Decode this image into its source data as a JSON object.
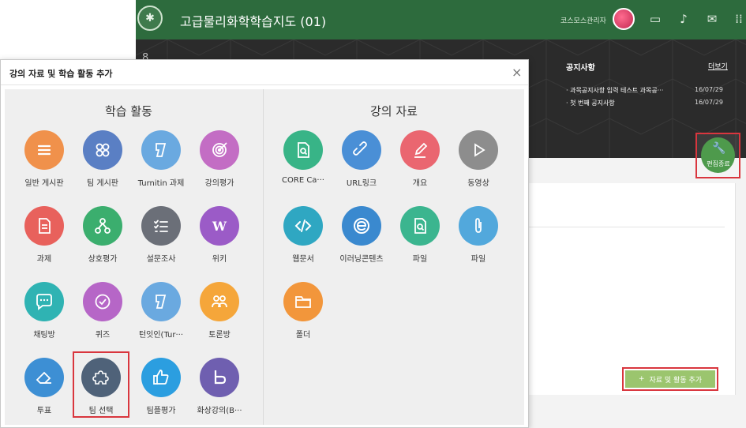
{
  "bg": {
    "course_title": "고급물리화학학습지도 (01)",
    "user_name": "코스모스관리자",
    "notice_title": "공지사항",
    "notice_more": "더보기",
    "notices": [
      {
        "text": "· 과목공지사항 입력 테스트 과목공···",
        "date": "16/07/29"
      },
      {
        "text": "· 첫 번째 공지사항",
        "date": "16/07/29"
      }
    ],
    "edit_done_label": "편집종료",
    "add_button_label": "자료 및 활동 추가",
    "add_button_icon": "+"
  },
  "modal": {
    "title": "강의 자료 및 학습 활동 추가",
    "close": "×",
    "activities_title": "학습 활동",
    "resources_title": "강의 자료",
    "activities": [
      {
        "label": "일반 게시판",
        "icon": "list-icon",
        "color": "#f0914b"
      },
      {
        "label": "팀 게시판",
        "icon": "grid-circles-icon",
        "color": "#5a7fc4"
      },
      {
        "label": "Turnitin 과제",
        "icon": "turnitin-icon",
        "color": "#6aa9e0"
      },
      {
        "label": "강의평가",
        "icon": "target-icon",
        "color": "#c36dc4"
      },
      {
        "label": "과제",
        "icon": "document-icon",
        "color": "#e8615c"
      },
      {
        "label": "상호평가",
        "icon": "network-icon",
        "color": "#3bae6e"
      },
      {
        "label": "설문조사",
        "icon": "checklist-icon",
        "color": "#6b6f78"
      },
      {
        "label": "위키",
        "icon": "wiki-icon",
        "color": "#9b5bc7"
      },
      {
        "label": "채팅방",
        "icon": "chat-icon",
        "color": "#2fb3b3"
      },
      {
        "label": "퀴즈",
        "icon": "check-circle-icon",
        "color": "#b666c7"
      },
      {
        "label": "턴잇인(Tur···",
        "icon": "turnitin-icon",
        "color": "#6aa9e0"
      },
      {
        "label": "토론방",
        "icon": "people-icon",
        "color": "#f5a63a"
      },
      {
        "label": "투표",
        "icon": "eraser-icon",
        "color": "#3d8fd4"
      },
      {
        "label": "팀 선택",
        "icon": "puzzle-icon",
        "color": "#4f6279"
      },
      {
        "label": "팀플평가",
        "icon": "thumbs-up-icon",
        "color": "#2b9ee0"
      },
      {
        "label": "화상강의(B···",
        "icon": "b-logo-icon",
        "color": "#6f5fb0"
      }
    ],
    "resources": [
      {
        "label": "CORE Ca···",
        "icon": "search-doc-icon",
        "color": "#38b487"
      },
      {
        "label": "URL링크",
        "icon": "link-icon",
        "color": "#4a8fd6"
      },
      {
        "label": "개요",
        "icon": "pencil-icon",
        "color": "#ea6670"
      },
      {
        "label": "동영상",
        "icon": "play-icon",
        "color": "#8d8d8d"
      },
      {
        "label": "웹문서",
        "icon": "code-icon",
        "color": "#2fa7c2"
      },
      {
        "label": "이러닝콘텐츠",
        "icon": "e-logo-icon",
        "color": "#3a89cf"
      },
      {
        "label": "파일",
        "icon": "search-doc-icon",
        "color": "#3bb58f"
      },
      {
        "label": "파일",
        "icon": "paperclip-icon",
        "color": "#52a8dc"
      },
      {
        "label": "폴더",
        "icon": "folder-icon",
        "color": "#f2963b"
      }
    ]
  }
}
